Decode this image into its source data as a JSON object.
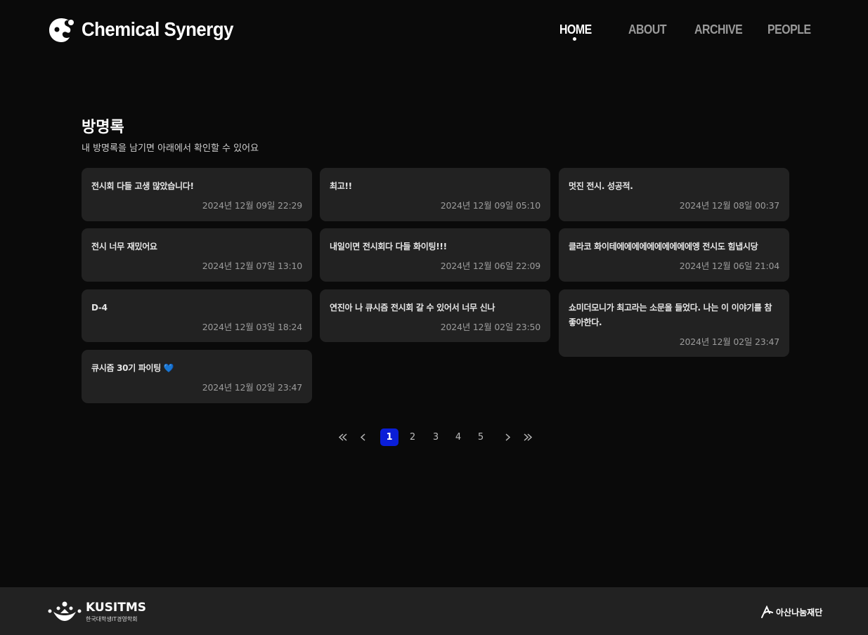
{
  "header": {
    "logo_text": "Chemical Synergy",
    "nav": [
      {
        "label": "HOME",
        "active": true
      },
      {
        "label": "ABOUT",
        "active": false
      },
      {
        "label": "ARCHIVE",
        "active": false
      },
      {
        "label": "PEOPLE",
        "active": false
      }
    ]
  },
  "guestbook": {
    "title": "방명록",
    "subtitle": "내 방명록을 남기면 아래에서 확인할 수 있어요",
    "entries": [
      {
        "message": "전시회 다들 고생 많았습니다!",
        "date": "2024년 12월 09일 22:29"
      },
      {
        "message": "최고!!",
        "date": "2024년 12월 09일 05:10"
      },
      {
        "message": "멋진 전시. 성공적.",
        "date": "2024년 12월 08일 00:37"
      },
      {
        "message": "전시 너무 재밌어요",
        "date": "2024년 12월 07일 13:10"
      },
      {
        "message": "내일이면 전시회다 다들 화이팅!!!",
        "date": "2024년 12월 06일 22:09"
      },
      {
        "message": "클라코 화이테에에에에에에에에에에엥 전시도 힘냅시당",
        "date": "2024년 12월 06일 21:04"
      },
      {
        "message": "D-4",
        "date": "2024년 12월 03일 18:24"
      },
      {
        "message": "연진아 나 큐시즘 전시회 갈 수 있어서 너무 신나",
        "date": "2024년 12월 02일 23:50"
      },
      {
        "message": "쇼미더모니가 최고라는 소문을 들었다. 나는 이 이야기를 참 좋아한다.",
        "date": "2024년 12월 02일 23:47"
      },
      {
        "message": "큐시즘 30기 파이팅 💙",
        "date": "2024년 12월 02일 23:47"
      }
    ]
  },
  "pagination": {
    "first_icon": "double-chevron-left-icon",
    "prev_icon": "chevron-left-icon",
    "pages": [
      "1",
      "2",
      "3",
      "4",
      "5"
    ],
    "current": "1",
    "next_icon": "chevron-right-icon",
    "last_icon": "double-chevron-right-icon",
    "accent": "#0a1ed8"
  },
  "footer": {
    "kusitms_title": "KUSITMS",
    "kusitms_sub": "한국대학생IT경영학회",
    "asan_text": "아산나눔재단"
  }
}
